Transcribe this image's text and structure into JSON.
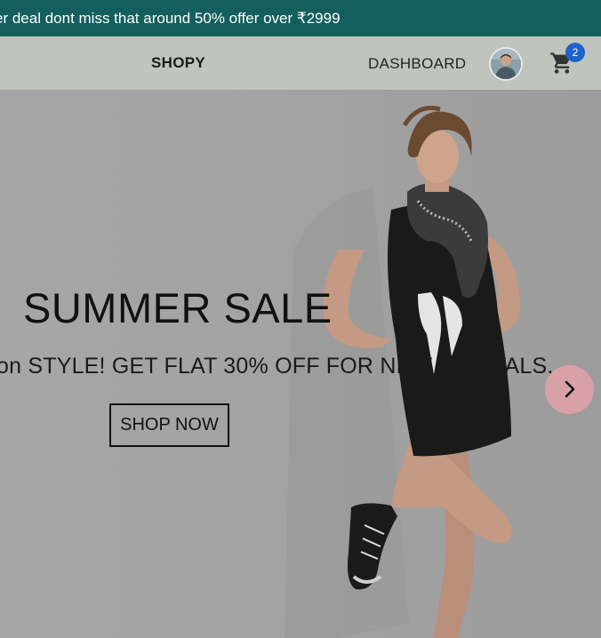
{
  "announcement": {
    "text": "er deal dont miss that around 50% offer over ₹2999"
  },
  "navbar": {
    "logo": "SHOPY",
    "links": [
      {
        "label": "DASHBOARD"
      }
    ],
    "avatar_icon": "user-avatar",
    "cart_icon": "shopping-cart-icon",
    "cart_count": "2"
  },
  "hero": {
    "title": "SUMMER SALE",
    "subtitle": "on STYLE! GET FLAT 30% OFF FOR NEW ARRIVALS..",
    "cta_label": "SHOP NOW",
    "next_icon": "chevron-right-icon"
  },
  "colors": {
    "announcement_bg": "#155e5e",
    "navbar_bg": "#bfc4bd",
    "badge": "#1e63c9",
    "next_button": "#d8a1a8"
  }
}
